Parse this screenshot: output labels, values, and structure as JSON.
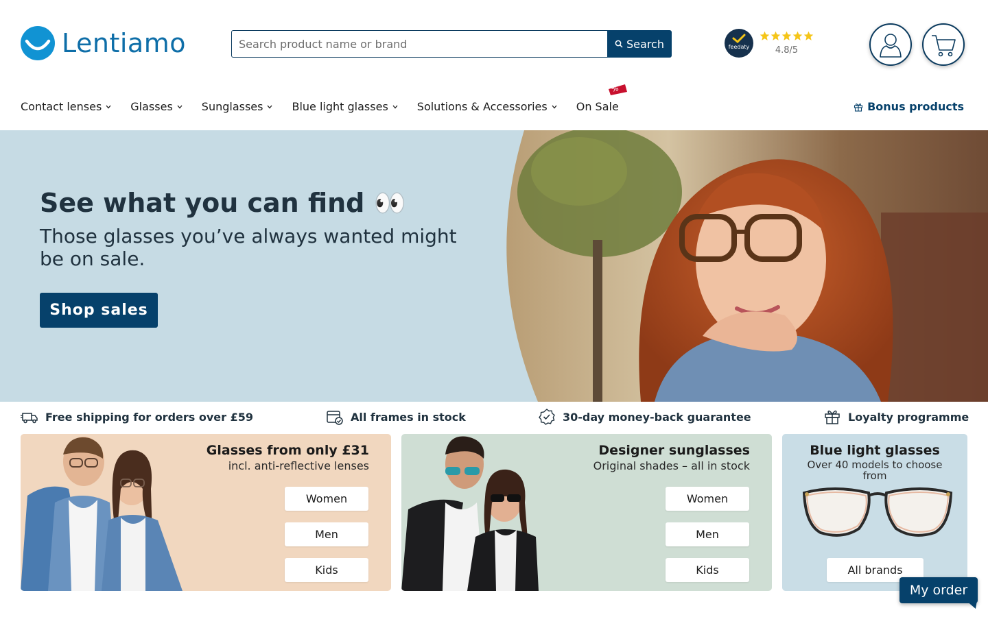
{
  "brand": {
    "name": "Lentiamo",
    "color": "#0e6ea8"
  },
  "search": {
    "placeholder": "Search product name or brand",
    "button_label": "Search"
  },
  "rating": {
    "badge_label": "feedaty",
    "stars": 5,
    "score": "4.8/5"
  },
  "header_icons": {
    "account": "user-icon",
    "cart": "cart-icon"
  },
  "nav": {
    "items": [
      {
        "label": "Contact lenses",
        "dropdown": true
      },
      {
        "label": "Glasses",
        "dropdown": true
      },
      {
        "label": "Sunglasses",
        "dropdown": true
      },
      {
        "label": "Blue light glasses",
        "dropdown": true
      },
      {
        "label": "Solutions & Accessories",
        "dropdown": true
      },
      {
        "label": "On Sale",
        "dropdown": false,
        "tag": "%"
      }
    ],
    "bonus_label": "Bonus products"
  },
  "hero": {
    "title": "See what you can find 👀",
    "subtitle": "Those glasses you’ve always wanted might be on sale.",
    "button_label": "Shop sales"
  },
  "usps": [
    {
      "icon": "delivery-truck-icon",
      "label": "Free shipping for orders over £59"
    },
    {
      "icon": "stock-box-icon",
      "label": "All frames in stock"
    },
    {
      "icon": "guarantee-badge-icon",
      "label": "30-day money-back guarantee"
    },
    {
      "icon": "gift-icon",
      "label": "Loyalty programme"
    }
  ],
  "cards": [
    {
      "title": "Glasses from only £31",
      "subtitle": "incl. anti-reflective lenses",
      "buttons": [
        "Women",
        "Men",
        "Kids"
      ]
    },
    {
      "title": "Designer sunglasses",
      "subtitle": "Original shades – all in stock",
      "buttons": [
        "Women",
        "Men",
        "Kids"
      ]
    },
    {
      "title": "Blue light glasses",
      "subtitle": "Over 40 models to choose from",
      "buttons": [
        "All brands"
      ]
    }
  ],
  "my_order_label": "My order",
  "colors": {
    "primary": "#06416b",
    "hero_bg": "#c6dbe4",
    "star": "#f5c518",
    "sale_tag": "#c8102e"
  }
}
